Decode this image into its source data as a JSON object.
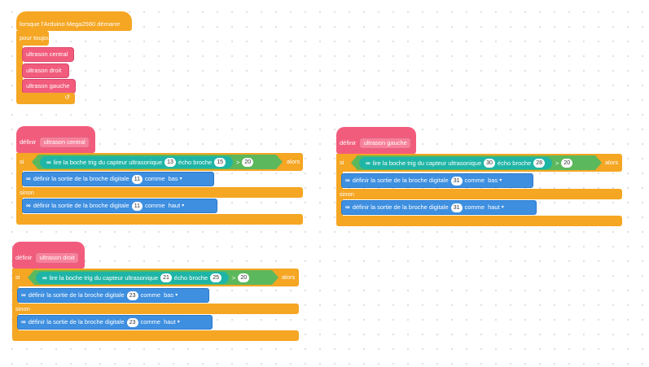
{
  "main_script": {
    "hat_label": "lorsque l'Arduino Mega2560 démarre",
    "loop_label": "pour toujours",
    "calls": [
      "ultrason central",
      "ultrason droit",
      "ultrason gauche"
    ]
  },
  "proc_central": {
    "define_label": "définir",
    "name": "ultrason central",
    "if_label": "si",
    "then_label": "alors",
    "else_label": "sinon",
    "sensor_label": "lire la boche trig du capteur ultrasonique",
    "trig_pin": "13",
    "echo_label": "écho broche",
    "echo_pin": "15",
    "op": ">",
    "threshold": "20",
    "set_label": "définir la sortie de la broche digitale",
    "comme_label": "comme",
    "pin_if": "11",
    "value_if": "bas",
    "pin_else": "11",
    "value_else": "haut"
  },
  "proc_gauche": {
    "define_label": "définir",
    "name": "ultrason gauche",
    "if_label": "si",
    "then_label": "alors",
    "else_label": "sinon",
    "sensor_label": "lire la boche trig du capteur ultrasonique",
    "trig_pin": "30",
    "echo_label": "écho broche",
    "echo_pin": "28",
    "op": ">",
    "threshold": "20",
    "set_label": "définir la sortie de la broche digitale",
    "comme_label": "comme",
    "pin_if": "31",
    "value_if": "bas",
    "pin_else": "31",
    "value_else": "haut"
  },
  "proc_droit": {
    "define_label": "définir",
    "name": "ultrason droit",
    "if_label": "si",
    "then_label": "alors",
    "else_label": "sinon",
    "sensor_label": "lire la boche trig du capteur ultrasonique",
    "trig_pin": "21",
    "echo_label": "écho broche",
    "echo_pin": "25",
    "op": ">",
    "threshold": "20",
    "set_label": "définir la sortie de la broche digitale",
    "comme_label": "comme",
    "pin_if": "23",
    "value_if": "bas",
    "pin_else": "23",
    "value_else": "haut"
  },
  "icons": {
    "infinity": "∞",
    "dropdown": "▾",
    "loop_arrow": "↺"
  },
  "colors": {
    "control": "#f5a623",
    "procedure": "#f25c7c",
    "arduino": "#3e8fe0",
    "sensor": "#1fb5a6",
    "operator": "#5cb85c"
  }
}
